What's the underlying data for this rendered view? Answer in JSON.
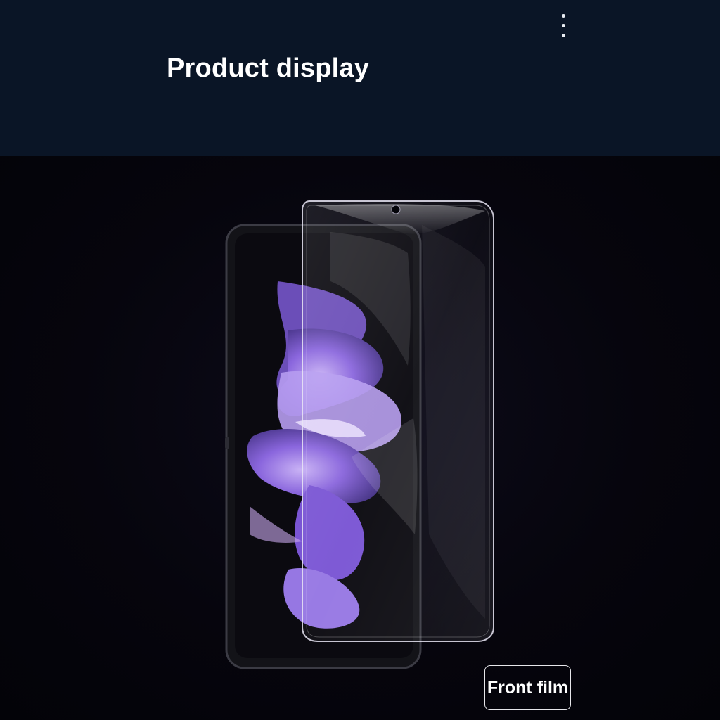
{
  "header": {
    "title": "Product display",
    "menu_icon": "more-vertical-icon",
    "background_color": "#0a1526"
  },
  "main": {
    "badge_label": "Front film",
    "background_color": "#05050c",
    "accent_color": "#8f6ee8"
  }
}
